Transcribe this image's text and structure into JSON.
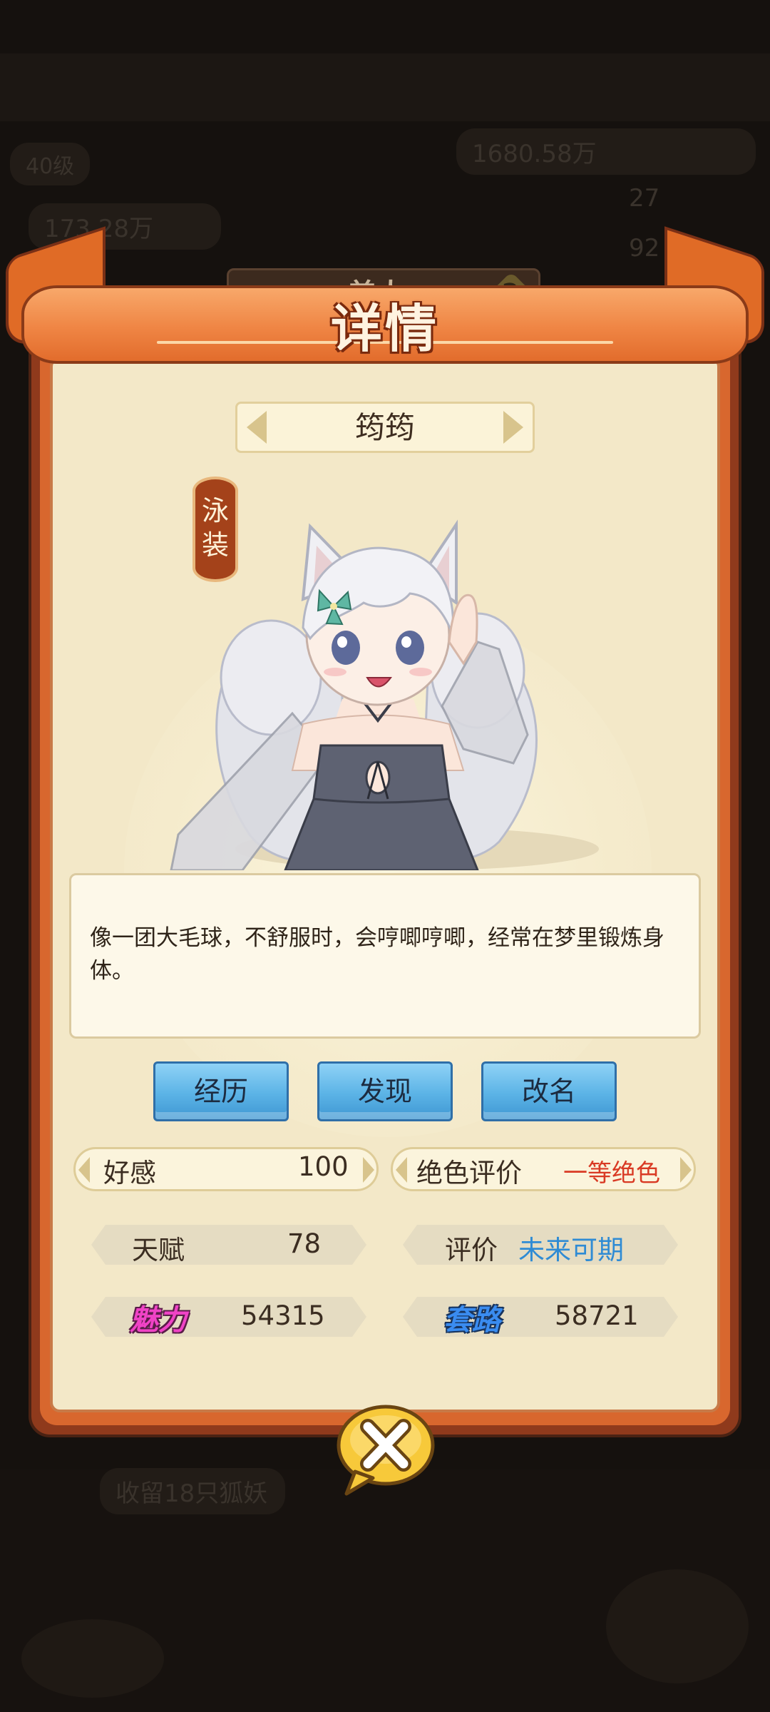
{
  "background": {
    "resource_value": "1680.58万",
    "level": "40级",
    "power_value": "173.28万",
    "count_a": "27",
    "count_b": "92",
    "quest_text": "收留18只狐妖"
  },
  "dialog": {
    "title_tab": "美人",
    "title": "详情",
    "close_label": "✕"
  },
  "character": {
    "name": "筠筠",
    "costume_tag": "泳装",
    "description": "像一团大毛球，不舒服时，会哼唧哼唧，经常在梦里锻炼身体。"
  },
  "buttons": {
    "history": "经历",
    "discover": "发现",
    "rename": "改名"
  },
  "stats": {
    "favor_label": "好感",
    "favor_value": "100",
    "beauty_label": "绝色评价",
    "beauty_value": "一等绝色",
    "talent_label": "天赋",
    "talent_value": "78",
    "rating_label": "评价",
    "rating_value": "未来可期",
    "charm_label": "魅力",
    "charm_value": "54315",
    "trick_label": "套路",
    "trick_value": "58721"
  },
  "colors": {
    "panel_bg": "#f3e8c8",
    "banner": "#ef8544",
    "button_blue": "#5bb3e6",
    "accent_red": "#d93a24",
    "accent_blue": "#2f8bd4",
    "charm_pink": "#f043c6",
    "trick_blue": "#3a8cf0"
  }
}
